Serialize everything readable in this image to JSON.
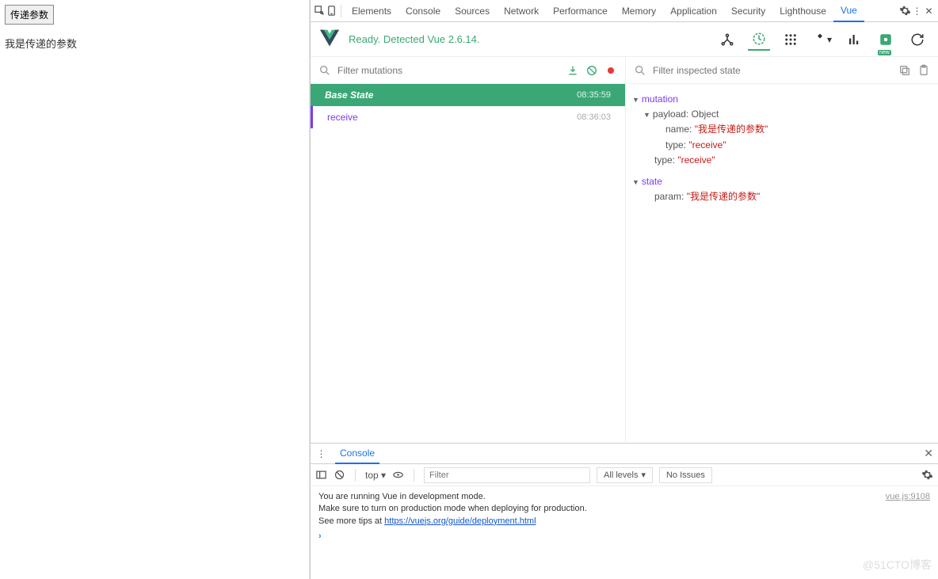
{
  "page": {
    "button_label": "传递参数",
    "output_text": "我是传递的参数"
  },
  "devtools_tabs": [
    "Elements",
    "Console",
    "Sources",
    "Network",
    "Performance",
    "Memory",
    "Application",
    "Security",
    "Lighthouse",
    "Vue"
  ],
  "devtools_active_tab": "Vue",
  "vue": {
    "status": "Ready. Detected Vue 2.6.14.",
    "filter_mutations_placeholder": "Filter mutations",
    "filter_state_placeholder": "Filter inspected state",
    "mutations": [
      {
        "label": "Base State",
        "time": "08:35:59",
        "base": true
      },
      {
        "label": "receive",
        "time": "08:36:03",
        "base": false
      }
    ],
    "inspected": {
      "mutation_label": "mutation",
      "payload_label": "payload",
      "payload_type_hint": "Object",
      "payload": {
        "name_key": "name",
        "name_val": "我是传递的参数",
        "type_key": "type",
        "type_val": "receive"
      },
      "outer_type_key": "type",
      "outer_type_val": "receive",
      "state_label": "state",
      "state": {
        "param_key": "param",
        "param_val": "我是传递的参数"
      }
    }
  },
  "console": {
    "tab_label": "Console",
    "context": "top",
    "filter_placeholder": "Filter",
    "levels": "All levels",
    "issues": "No Issues",
    "source_ref": "vue.js:9108",
    "msg_line1": "You are running Vue in development mode.",
    "msg_line2": "Make sure to turn on production mode when deploying for production.",
    "msg_line3_prefix": "See more tips at ",
    "msg_line3_link": "https://vuejs.org/guide/deployment.html"
  },
  "watermark": "@51CTO博客"
}
